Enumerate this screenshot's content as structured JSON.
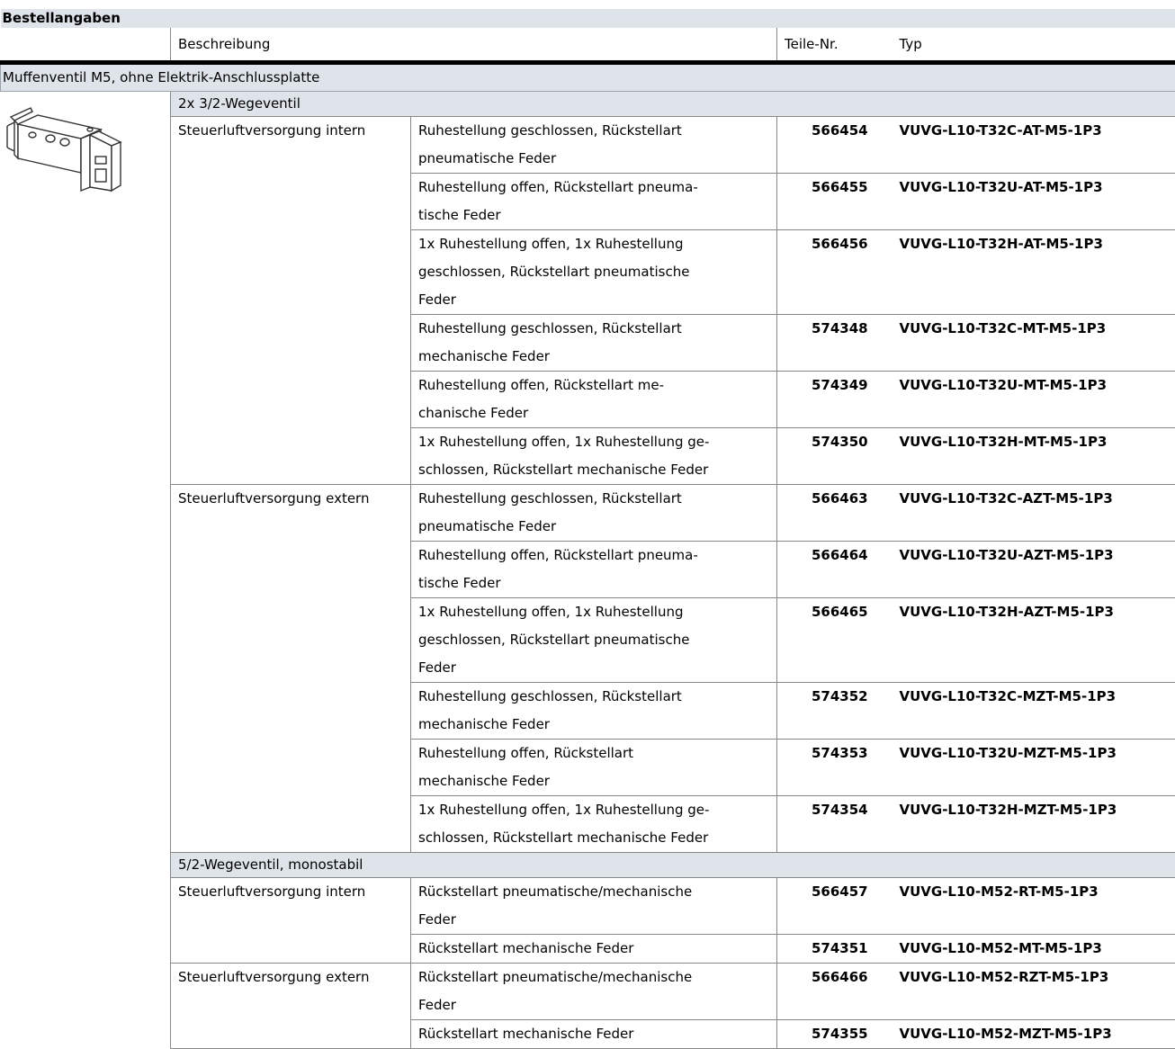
{
  "title": "Bestellangaben",
  "headers": {
    "beschreibung": "Beschreibung",
    "teilenr": "Teile-Nr.",
    "typ": "Typ"
  },
  "section": "Muffenventil M5, ohne Elektrik-Anschlussplatte",
  "groups": [
    {
      "label": "2x 3/2-Wegeventil",
      "supplies": [
        {
          "label": "Steuerluftversorgung intern",
          "rows": [
            {
              "desc": [
                "Ruhestellung geschlossen, Rückstellart",
                "pneumatische Feder"
              ],
              "nr": "566454",
              "typ": "VUVG-L10-T32C-AT-M5-1P3"
            },
            {
              "desc": [
                "Ruhestellung offen, Rückstellart pneuma-",
                "tische Feder"
              ],
              "nr": "566455",
              "typ": "VUVG-L10-T32U-AT-M5-1P3"
            },
            {
              "desc": [
                "1x Ruhestellung offen, 1x Ruhestellung",
                "geschlossen, Rückstellart pneumatische",
                "Feder"
              ],
              "nr": "566456",
              "typ": "VUVG-L10-T32H-AT-M5-1P3"
            },
            {
              "desc": [
                "Ruhestellung geschlossen, Rückstellart",
                "mechanische Feder"
              ],
              "nr": "574348",
              "typ": "VUVG-L10-T32C-MT-M5-1P3"
            },
            {
              "desc": [
                "Ruhestellung offen, Rückstellart me-",
                "chanische Feder"
              ],
              "nr": "574349",
              "typ": "VUVG-L10-T32U-MT-M5-1P3"
            },
            {
              "desc": [
                "1x Ruhestellung offen, 1x Ruhestellung ge-",
                "schlossen, Rückstellart mechanische Feder"
              ],
              "nr": "574350",
              "typ": "VUVG-L10-T32H-MT-M5-1P3"
            }
          ]
        },
        {
          "label": "Steuerluftversorgung extern",
          "rows": [
            {
              "desc": [
                "Ruhestellung geschlossen, Rückstellart",
                "pneumatische Feder"
              ],
              "nr": "566463",
              "typ": "VUVG-L10-T32C-AZT-M5-1P3"
            },
            {
              "desc": [
                "Ruhestellung offen, Rückstellart pneuma-",
                "tische Feder"
              ],
              "nr": "566464",
              "typ": "VUVG-L10-T32U-AZT-M5-1P3"
            },
            {
              "desc": [
                "1x Ruhestellung offen, 1x Ruhestellung",
                "geschlossen, Rückstellart pneumatische",
                "Feder"
              ],
              "nr": "566465",
              "typ": "VUVG-L10-T32H-AZT-M5-1P3"
            },
            {
              "desc": [
                "Ruhestellung geschlossen, Rückstellart",
                "mechanische Feder"
              ],
              "nr": "574352",
              "typ": "VUVG-L10-T32C-MZT-M5-1P3"
            },
            {
              "desc": [
                "Ruhestellung offen, Rückstellart",
                "mechanische Feder"
              ],
              "nr": "574353",
              "typ": "VUVG-L10-T32U-MZT-M5-1P3"
            },
            {
              "desc": [
                "1x Ruhestellung offen, 1x Ruhestellung ge-",
                "schlossen, Rückstellart mechanische Feder"
              ],
              "nr": "574354",
              "typ": "VUVG-L10-T32H-MZT-M5-1P3"
            }
          ]
        }
      ]
    },
    {
      "label": "5/2-Wegeventil, monostabil",
      "supplies": [
        {
          "label": "Steuerluftversorgung intern",
          "rows": [
            {
              "desc": [
                "Rückstellart pneumatische/mechanische",
                "Feder"
              ],
              "nr": "566457",
              "typ": "VUVG-L10-M52-RT-M5-1P3"
            },
            {
              "desc": [
                "Rückstellart mechanische Feder"
              ],
              "nr": "574351",
              "typ": "VUVG-L10-M52-MT-M5-1P3"
            }
          ]
        },
        {
          "label": "Steuerluftversorgung extern",
          "rows": [
            {
              "desc": [
                "Rückstellart pneumatische/mechanische",
                "Feder"
              ],
              "nr": "566466",
              "typ": "VUVG-L10-M52-RZT-M5-1P3"
            },
            {
              "desc": [
                "Rückstellart mechanische Feder"
              ],
              "nr": "574355",
              "typ": "VUVG-L10-M52-MZT-M5-1P3"
            }
          ]
        }
      ]
    }
  ],
  "image": {
    "icon": "valve-product-image"
  }
}
